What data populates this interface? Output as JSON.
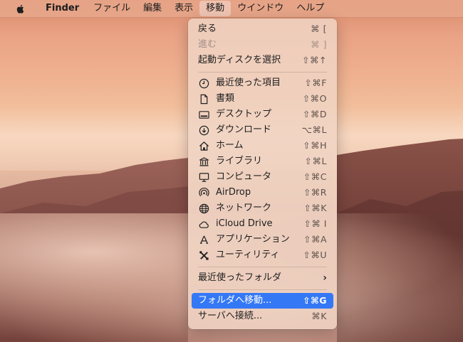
{
  "menubar": {
    "apple_icon": "apple-icon",
    "items": [
      "Finder",
      "ファイル",
      "編集",
      "表示",
      "移動",
      "ウインドウ",
      "ヘルプ"
    ],
    "active": "移動"
  },
  "menu": {
    "back": {
      "label": "戻る",
      "shortcut": "⌘ ["
    },
    "forward": {
      "label": "進む",
      "shortcut": "⌘ ]"
    },
    "startup": {
      "label": "起動ディスクを選択",
      "shortcut": "⇧⌘↑"
    },
    "places": [
      {
        "label": "最近使った項目",
        "shortcut": "⇧⌘F",
        "icon": "clock-icon"
      },
      {
        "label": "書類",
        "shortcut": "⇧⌘O",
        "icon": "document-icon"
      },
      {
        "label": "デスクトップ",
        "shortcut": "⇧⌘D",
        "icon": "desktop-icon"
      },
      {
        "label": "ダウンロード",
        "shortcut": "⌥⌘L",
        "icon": "download-icon"
      },
      {
        "label": "ホーム",
        "shortcut": "⇧⌘H",
        "icon": "home-icon"
      },
      {
        "label": "ライブラリ",
        "shortcut": "⇧⌘L",
        "icon": "library-icon"
      },
      {
        "label": "コンピュータ",
        "shortcut": "⇧⌘C",
        "icon": "computer-icon"
      },
      {
        "label": "AirDrop",
        "shortcut": "⇧⌘R",
        "icon": "airdrop-icon"
      },
      {
        "label": "ネットワーク",
        "shortcut": "⇧⌘K",
        "icon": "network-icon"
      },
      {
        "label": "iCloud Drive",
        "shortcut": "⇧⌘ I",
        "icon": "cloud-icon"
      },
      {
        "label": "アプリケーション",
        "shortcut": "⇧⌘A",
        "icon": "applications-icon"
      },
      {
        "label": "ユーティリティ",
        "shortcut": "⇧⌘U",
        "icon": "utilities-icon"
      }
    ],
    "recent_folders": {
      "label": "最近使ったフォルダ"
    },
    "go_to_folder": {
      "label": "フォルダへ移動...",
      "shortcut": "⇧⌘G"
    },
    "connect_server": {
      "label": "サーバへ接続...",
      "shortcut": "⌘K"
    }
  },
  "colors": {
    "highlight": "#3478f6",
    "menubar": "#e8a88c"
  }
}
